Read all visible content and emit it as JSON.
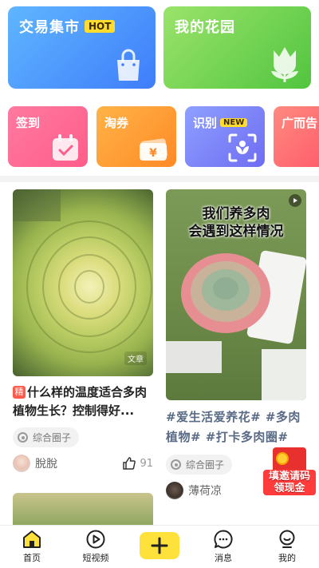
{
  "top_cards": {
    "market": {
      "title": "交易集市",
      "badge": "HOT",
      "color": "#3f7dfb"
    },
    "garden": {
      "title": "我的花园",
      "color": "#51c53f"
    }
  },
  "tiles": [
    {
      "label": "签到",
      "icon": "calendar-check-icon"
    },
    {
      "label": "淘券",
      "icon": "yen-coupon-icon"
    },
    {
      "label": "识别",
      "badge": "NEW",
      "icon": "scan-plant-icon"
    },
    {
      "label": "广而告",
      "icon": "megaphone-icon"
    }
  ],
  "feed": [
    {
      "flag": "精",
      "title": "什么样的温度适合多肉植物生长？控制得好...",
      "image_tag": "文章",
      "circle": "综合圈子",
      "author": "脫脫",
      "likes": "91"
    },
    {
      "overlay_line1": "我们养多肉",
      "overlay_line2": "会遇到这样情况",
      "hashtags": "#爱生活爱养花# #多肉植物# #打卡多肉圈#",
      "circle": "综合圈子",
      "author": "薄荷凉"
    }
  ],
  "promo": {
    "line1": "填邀请码",
    "line2": "领现金"
  },
  "tabbar": [
    {
      "label": "首页",
      "icon": "home-icon"
    },
    {
      "label": "短视频",
      "icon": "play-video-icon"
    },
    {
      "label": "",
      "icon": "plus-icon"
    },
    {
      "label": "消息",
      "icon": "message-icon"
    },
    {
      "label": "我的",
      "icon": "profile-icon"
    }
  ],
  "colors": {
    "accent": "#ffe13c",
    "hashtag": "#5a6b86",
    "flag": "#ff5a4a"
  }
}
